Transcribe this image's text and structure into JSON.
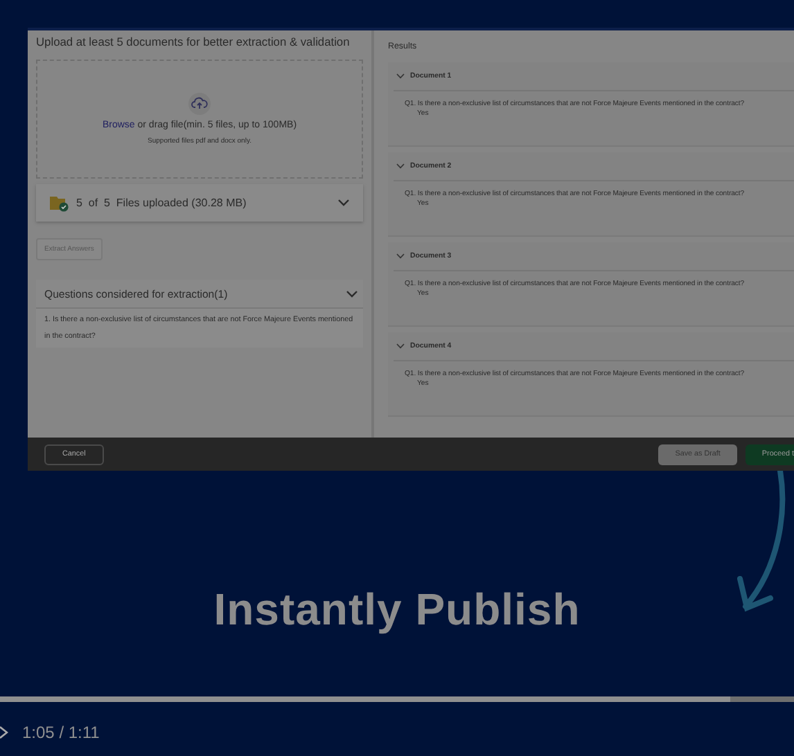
{
  "upload": {
    "heading": "Upload at least 5 documents for better extraction & validation",
    "browse_link": "Browse",
    "drop_text": " or drag file(min. 5 files, up to 100MB)",
    "supported": "Supported files pdf and docx only."
  },
  "files": {
    "summary": "5  of  5  Files uploaded (30.28 MB)",
    "expanded": false
  },
  "extract_button": {
    "label": "Extract Answers",
    "disabled": true
  },
  "questions": {
    "title": "Questions considered for extraction(1)",
    "expanded": true,
    "items": [
      "1. Is there a non-exclusive list of circumstances that are not Force Majeure Events mentioned in the contract?"
    ]
  },
  "results": {
    "title": "Results",
    "documents": [
      {
        "name": "Document 1",
        "expanded": true,
        "answers": [
          {
            "question": "Q1. Is there a non-exclusive list of circumstances that are not Force Majeure Events mentioned in the contract?",
            "answer": "Yes"
          }
        ]
      },
      {
        "name": "Document 2",
        "expanded": true,
        "answers": [
          {
            "question": "Q1. Is there a non-exclusive list of circumstances that are not Force Majeure Events mentioned in the contract?",
            "answer": "Yes"
          }
        ]
      },
      {
        "name": "Document 3",
        "expanded": true,
        "answers": [
          {
            "question": "Q1. Is there a non-exclusive list of circumstances that are not Force Majeure Events mentioned in the contract?",
            "answer": "Yes"
          }
        ]
      },
      {
        "name": "Document 4",
        "expanded": true,
        "answers": [
          {
            "question": "Q1. Is there a non-exclusive list of circumstances that are not Force Majeure Events mentioned in the contract?",
            "answer": "Yes"
          }
        ]
      }
    ]
  },
  "footer": {
    "buttons": [
      {
        "label": "Cancel",
        "kind": "outline"
      },
      {
        "label": "Save as Draft",
        "kind": "secondary"
      },
      {
        "label": "Proceed t",
        "kind": "primary"
      }
    ]
  },
  "caption": "Instantly Publish",
  "player": {
    "time": "1:05 / 1:11",
    "progress": {
      "level": 0.92
    }
  }
}
